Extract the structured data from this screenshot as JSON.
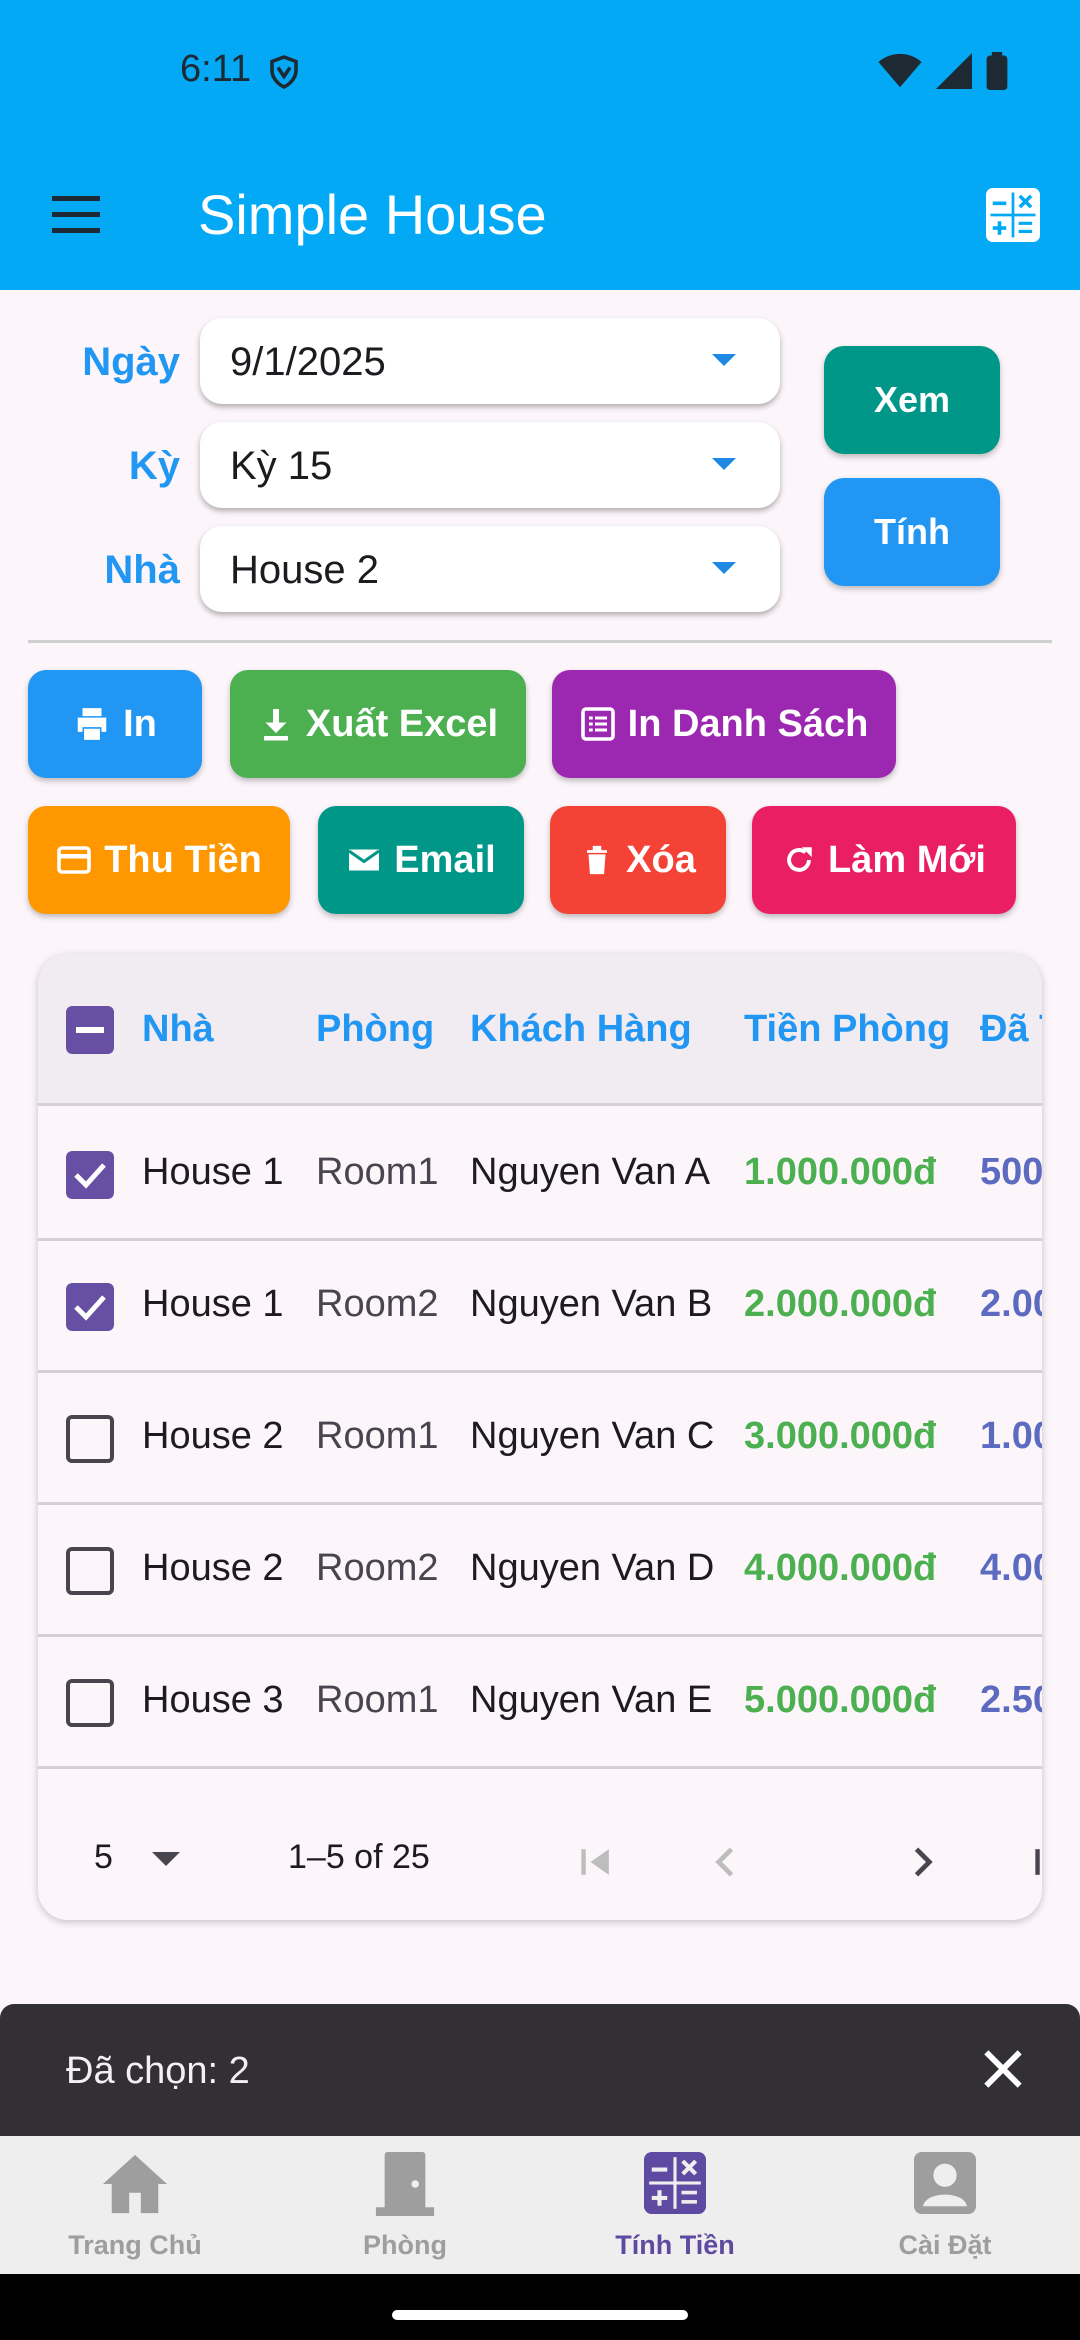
{
  "status_bar": {
    "time": "6:11"
  },
  "app_bar": {
    "title": "Simple House"
  },
  "filters": {
    "date": {
      "label": "Ngày",
      "value": "9/1/2025"
    },
    "period": {
      "label": "Kỳ",
      "value": "Kỳ 15"
    },
    "house": {
      "label": "Nhà",
      "value": "House 2"
    }
  },
  "side_buttons": {
    "view": "Xem",
    "calculate": "Tính"
  },
  "actions": {
    "print": "In",
    "export_excel": "Xuất Excel",
    "print_list": "In Danh Sách",
    "collect": "Thu Tiền",
    "email": "Email",
    "delete": "Xóa",
    "refresh": "Làm Mới"
  },
  "colors": {
    "primary": "#03a9f4",
    "print": "#2196f3",
    "excel": "#4caf50",
    "print_list": "#9c27b0",
    "collect": "#ff9800",
    "email": "#009688",
    "delete": "#f44336",
    "refresh": "#e91e63",
    "view": "#009688",
    "calculate": "#2196f3"
  },
  "table": {
    "columns": [
      "Nhà",
      "Phòng",
      "Khách Hàng",
      "Tiền Phòng",
      "Đã T"
    ],
    "rows": [
      {
        "selected": true,
        "house": "House 1",
        "room": "Room1",
        "customer": "Nguyen Van A",
        "rent": "1.000.000đ",
        "paid": "500"
      },
      {
        "selected": true,
        "house": "House 1",
        "room": "Room2",
        "customer": "Nguyen Van B",
        "rent": "2.000.000đ",
        "paid": "2.00"
      },
      {
        "selected": false,
        "house": "House 2",
        "room": "Room1",
        "customer": "Nguyen Van C",
        "rent": "3.000.000đ",
        "paid": "1.00"
      },
      {
        "selected": false,
        "house": "House 2",
        "room": "Room2",
        "customer": "Nguyen Van D",
        "rent": "4.000.000đ",
        "paid": "4.00"
      },
      {
        "selected": false,
        "house": "House 3",
        "room": "Room1",
        "customer": "Nguyen Van E",
        "rent": "5.000.000đ",
        "paid": "2.50"
      }
    ],
    "pagination": {
      "rows_per_page": "5",
      "range": "1–5 of 25"
    }
  },
  "snackbar": {
    "text": "Đã chọn: 2"
  },
  "bottom_nav": {
    "items": [
      {
        "label": "Trang Chủ",
        "icon": "home-icon"
      },
      {
        "label": "Phòng",
        "icon": "door-icon"
      },
      {
        "label": "Tính Tiền",
        "icon": "calculator-icon",
        "active": true
      },
      {
        "label": "Cài Đặt",
        "icon": "account-icon"
      }
    ]
  }
}
